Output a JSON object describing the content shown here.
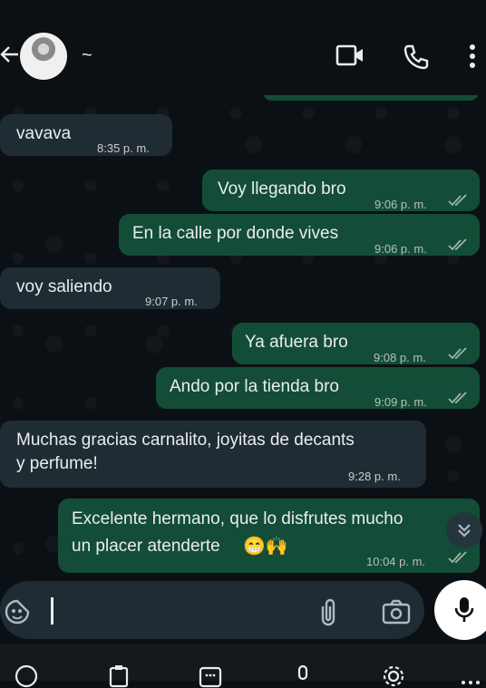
{
  "header": {
    "contact_name": "~",
    "icons": [
      "back-arrow-icon",
      "video-call-icon",
      "phone-icon",
      "more-vert-icon"
    ]
  },
  "messages": [
    {
      "dir": "in",
      "text": "vavava",
      "time": "8:35 p. m."
    },
    {
      "dir": "out",
      "text": "Voy llegando bro",
      "time": "9:06 p. m.",
      "status": "read"
    },
    {
      "dir": "out",
      "text": "En la calle por donde vives",
      "time": "9:06 p. m.",
      "status": "read"
    },
    {
      "dir": "in",
      "text": "voy saliendo",
      "time": "9:07 p. m."
    },
    {
      "dir": "out",
      "text": "Ya afuera bro",
      "time": "9:08 p. m.",
      "status": "read"
    },
    {
      "dir": "out",
      "text": "Ando por la tienda bro",
      "time": "9:09 p. m.",
      "status": "read"
    },
    {
      "dir": "in",
      "line1": "Muchas gracias carnalito, joyitas de decants",
      "line2": "y perfume!",
      "time": "9:28 p. m."
    },
    {
      "dir": "out",
      "line1": "Excelente hermano, que lo disfrutes mucho",
      "line2": "un placer atenderte",
      "emoji": "😁🙌",
      "time": "10:04 p. m.",
      "status": "read"
    }
  ],
  "input": {
    "icons": [
      "sticker-icon",
      "attach-icon",
      "camera-icon",
      "mic-icon"
    ]
  },
  "keyboard_toolbar": {
    "icons": [
      "emoji-icon",
      "clipboard-icon",
      "keypad-icon",
      "voice-icon",
      "settings-icon",
      "more-icon"
    ]
  },
  "colors": {
    "background": "#0b1014",
    "incoming_bubble": "#1f2c33",
    "outgoing_bubble": "#144d37",
    "read_ticks": "#9fb3ad"
  }
}
